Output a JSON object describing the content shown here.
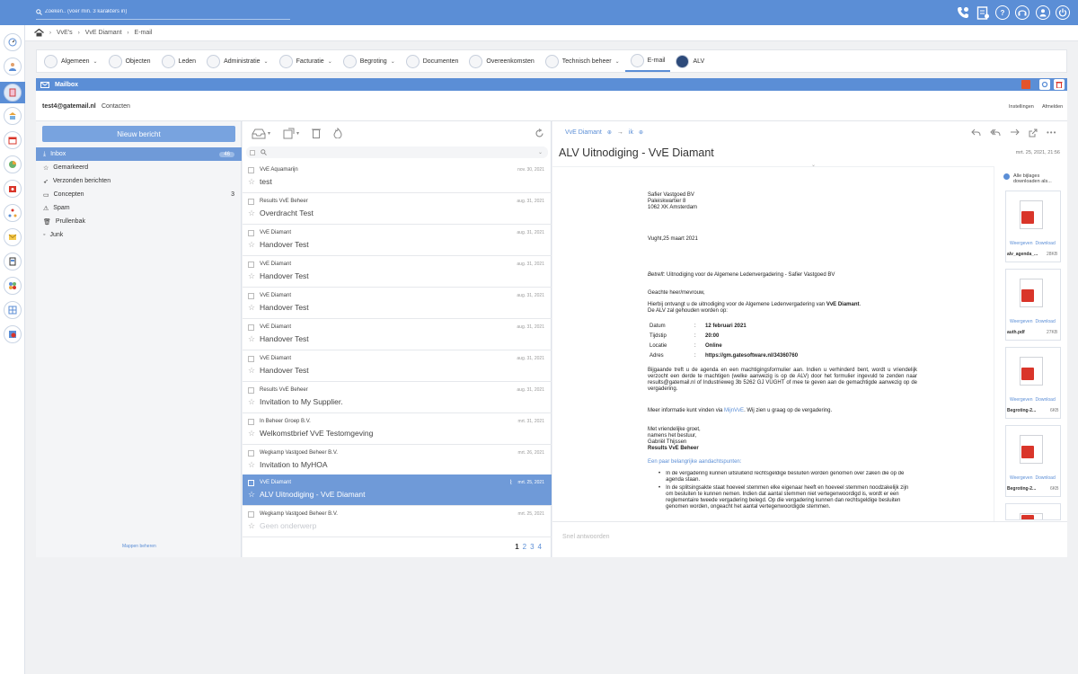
{
  "search": {
    "placeholder": "Zoeken.. (voer min. 3 karakters in)"
  },
  "breadcrumb": [
    "VvE's",
    "VvE Diamant",
    "E-mail"
  ],
  "modules": [
    {
      "label": "Algemeen",
      "dropdown": true
    },
    {
      "label": "Objecten",
      "dropdown": false
    },
    {
      "label": "Leden",
      "dropdown": false
    },
    {
      "label": "Administratie",
      "dropdown": true
    },
    {
      "label": "Facturatie",
      "dropdown": true
    },
    {
      "label": "Begroting",
      "dropdown": true
    },
    {
      "label": "Documenten",
      "dropdown": false
    },
    {
      "label": "Overeenkomsten",
      "dropdown": false
    },
    {
      "label": "Technisch beheer",
      "dropdown": true
    },
    {
      "label": "E-mail",
      "dropdown": false,
      "active": true
    },
    {
      "label": "ALV",
      "dropdown": false
    }
  ],
  "mailbox": {
    "title": "Mailbox",
    "account": "test4@gatemail.nl",
    "contacts": "Contacten",
    "settings": "Instellingen",
    "logout": "Afmelden"
  },
  "folders": {
    "new_message": "Nieuw bericht",
    "items": [
      {
        "label": "Inbox",
        "count": "46"
      },
      {
        "label": "Gemarkeerd",
        "count": ""
      },
      {
        "label": "Verzonden berichten",
        "count": ""
      },
      {
        "label": "Concepten",
        "count": "3"
      },
      {
        "label": "Spam",
        "count": ""
      },
      {
        "label": "Prullenbak",
        "count": ""
      },
      {
        "label": "Junk",
        "count": ""
      }
    ],
    "manage": "Mappen beheren"
  },
  "messages": [
    {
      "from": "VvE Aquamarijn",
      "subject": "test",
      "date": "nov. 30, 2021"
    },
    {
      "from": "Results VvE Beheer",
      "subject": "Overdracht Test",
      "date": "aug. 31, 2021"
    },
    {
      "from": "VvE Diamant",
      "subject": "Handover Test",
      "date": "aug. 31, 2021"
    },
    {
      "from": "VvE Diamant",
      "subject": "Handover Test",
      "date": "aug. 31, 2021"
    },
    {
      "from": "VvE Diamant",
      "subject": "Handover Test",
      "date": "aug. 31, 2021"
    },
    {
      "from": "VvE Diamant",
      "subject": "Handover Test",
      "date": "aug. 31, 2021"
    },
    {
      "from": "VvE Diamant",
      "subject": "Handover Test",
      "date": "aug. 31, 2021"
    },
    {
      "from": "Results VvE Beheer",
      "subject": "Invitation to My Supplier.",
      "date": "aug. 31, 2021"
    },
    {
      "from": "In Beheer Groep B.V.",
      "subject": "Welkomstbrief VvE Testomgeving",
      "date": "mrt. 31, 2021"
    },
    {
      "from": "Wegkamp Vastgoed Beheer B.V.",
      "subject": "Invitation to MyHOA",
      "date": "mrt. 26, 2021"
    },
    {
      "from": "VvE Diamant",
      "subject": "ALV Uitnodiging - VvE Diamant",
      "date": "mrt. 25, 2021"
    },
    {
      "from": "Wegkamp Vastgoed Beheer B.V.",
      "subject": "Geen onderwerp",
      "date": "mrt. 25, 2021"
    }
  ],
  "pagination": [
    "1",
    "2",
    "3",
    "4"
  ],
  "reader": {
    "from": "VvE Diamant",
    "arrow": "→",
    "to": "ik",
    "subject": "ALV Uitnodiging - VvE Diamant",
    "datetime": "mrt. 25, 2021, 21:56",
    "reply_placeholder": "Snel antwoorden",
    "letter": {
      "addr1": "Safier Vastgoed BV",
      "addr2": "Paleiskwartier 8",
      "addr3": "1062 XK Amsterdam",
      "place_date": "Vught,25 maart 2021",
      "betreft_label": "Betreft:",
      "betreft": " Uitnodiging voor de Algemene Ledenvergadering - Safier Vastgoed BV",
      "salutation": "Geachte heer/mevrouw,",
      "p1a": "Hierbij ontvangt u de uitnodiging voor de Algemene Ledenvergadering van ",
      "p1b": "VvE Diamant",
      "p1c": ".",
      "p1d": "De ALV zal gehouden worden op:",
      "details": [
        {
          "k": "Datum",
          "v": "12 februari 2021"
        },
        {
          "k": "Tijdstip",
          "v": "20:00"
        },
        {
          "k": "Locatie",
          "v": "Online"
        },
        {
          "k": "Adres",
          "v": "https://gm.gatesoftware.nl/34360760"
        }
      ],
      "p2": "Bijgaande treft u de agenda en een machtigingsformulier aan. Indien u verhinderd bent, wordt u vriendelijk verzocht een derde te machtigen (welke aanwezig is op de ALV) door het formulier ingevuld te zenden naar results@gatemail.nl of Industrieweg 3b 5262 GJ VUGHT of mee te geven aan de gemachtigde aanwezig op de vergadering.",
      "p3a": "Meer informatie kunt vinden via ",
      "p3link": "MijnVvE",
      "p3b": ". Wij zien u graag op de vergadering.",
      "closing1": "Met vriendelijke groet,",
      "closing2": "namens het bestuur,",
      "closing3": "Gabriël Thijssen",
      "closing4": "Results VvE Beheer",
      "notes_title": "Een paar belangrijke aandachtspunten:",
      "note1": "In de vergadering kunnen uitsluitend rechtsgeldige besluiten worden genomen over zaken die op de agenda staan.",
      "note2": "In de splitsingsakte staat hoeveel stemmen elke eigenaar heeft en hoeveel stemmen noodzakelijk zijn om besluiten te kunnen nemen. Indien dat aantal stemmen niet vertegenwoordigd is, wordt er een reglementaire tweede vergadering belegd. Op die vergadering kunnen dan rechtsgeldige besluiten genomen worden, ongeacht het aantal vertegenwoordigde stemmen."
    },
    "download_all": "Alle bijlages downloaden als...",
    "attachments": [
      {
        "name": "alv_agenda_...",
        "size": "28KB",
        "view": "Weergeven",
        "download": "Download"
      },
      {
        "name": "auth.pdf",
        "size": "27KB",
        "view": "Weergeven",
        "download": "Download"
      },
      {
        "name": "Begroting-2...",
        "size": "6KB",
        "view": "Weergeven",
        "download": "Download"
      },
      {
        "name": "Begroting-2...",
        "size": "6KB",
        "view": "Weergeven",
        "download": "Download"
      }
    ]
  },
  "colors": {
    "accent": "#5b8ed6",
    "selected": "#6f9ad8",
    "button": "#78a3df",
    "pdf_red": "#d9352a"
  }
}
